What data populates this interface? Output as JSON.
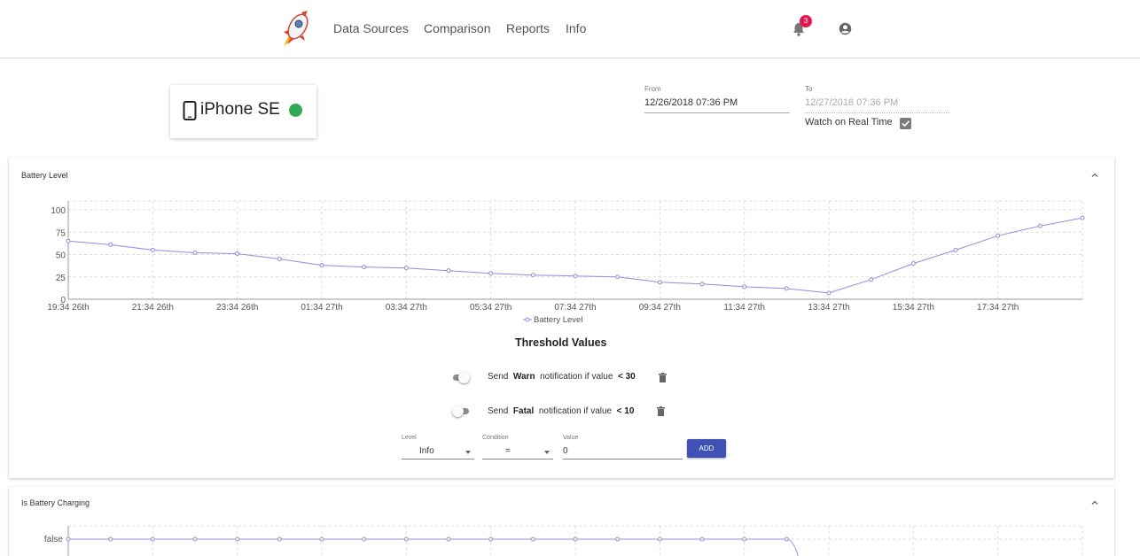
{
  "nav": {
    "links": [
      "Data Sources",
      "Comparison",
      "Reports",
      "Info"
    ],
    "notification_count": "3"
  },
  "device": {
    "name": "iPhone SE",
    "status_color": "#35a853"
  },
  "range": {
    "from_label": "From",
    "from_value": "12/26/2018 07:36 PM",
    "to_label": "To",
    "to_value": "12/27/2018 07:36 PM",
    "realtime_label": "Watch on Real Time",
    "realtime_checked": true
  },
  "battery_panel": {
    "title": "Battery Level",
    "chart_data": {
      "type": "line",
      "x_tick_labels": [
        "19:34 26th",
        "21:34 26th",
        "23:34 26th",
        "01:34 27th",
        "03:34 27th",
        "05:34 27th",
        "07:34 27th",
        "09:34 27th",
        "11:34 27th",
        "13:34 27th",
        "15:34 27th",
        "17:34 27th"
      ],
      "y_tick_labels": [
        "0",
        "25",
        "50",
        "75",
        "100"
      ],
      "ylim": [
        0,
        100
      ],
      "grid": true,
      "legend": "bottom-center",
      "series": [
        {
          "name": "Battery Level",
          "color": "#8b8fdc",
          "x_hours": [
            0,
            1,
            2,
            3,
            4,
            5,
            6,
            7,
            8,
            9,
            10,
            11,
            12,
            13,
            14,
            15,
            16,
            17,
            18,
            19,
            20,
            21,
            22,
            23,
            24
          ],
          "values": [
            65,
            61,
            55,
            52,
            51,
            45,
            38,
            36,
            35,
            32,
            29,
            27,
            26,
            25,
            19,
            17,
            14,
            12,
            7,
            22,
            40,
            55,
            71,
            82,
            91
          ]
        }
      ]
    }
  },
  "thresholds": {
    "heading": "Threshold Values",
    "rules": [
      {
        "prefix": "Send",
        "level": "Warn",
        "middle": "notification if value",
        "condition": "< 30",
        "enabled": true
      },
      {
        "prefix": "Send",
        "level": "Fatal",
        "middle": "notification if value",
        "condition": "< 10",
        "enabled": false
      }
    ],
    "form": {
      "level_label": "Level",
      "level_value": "Info",
      "condition_label": "Condition",
      "condition_value": "=",
      "value_label": "Value",
      "value_value": "0",
      "add_label": "ADD"
    }
  },
  "charging_panel": {
    "title": "Is Battery Charging",
    "chart_data": {
      "type": "line",
      "y_tick_labels": [
        "false"
      ],
      "grid": true,
      "series": [
        {
          "color": "#8b8fdc",
          "x_hours": [
            0,
            1,
            2,
            3,
            4,
            5,
            6,
            7,
            8,
            9,
            10,
            11,
            12,
            13,
            14,
            15,
            16,
            17
          ],
          "values": [
            "false",
            "false",
            "false",
            "false",
            "false",
            "false",
            "false",
            "false",
            "false",
            "false",
            "false",
            "false",
            "false",
            "false",
            "false",
            "false",
            "false",
            "false"
          ]
        }
      ]
    }
  }
}
